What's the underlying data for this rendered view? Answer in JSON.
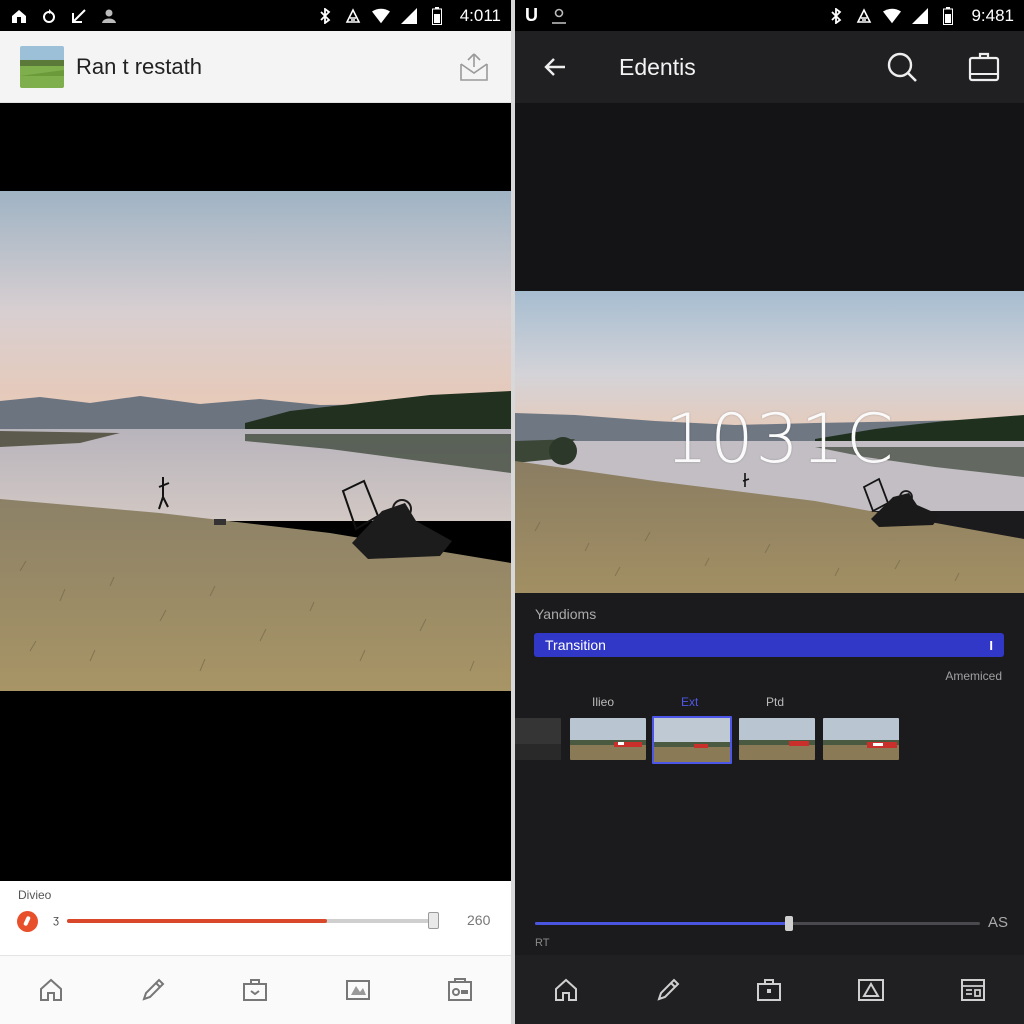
{
  "left": {
    "status": {
      "time": "4:011",
      "left_icons": [
        "home-status-icon",
        "sync-icon",
        "signal-arrow-icon",
        "person-icon"
      ],
      "right_icons": [
        "bluetooth-icon",
        "vibrate-icon",
        "wifi-icon",
        "battery-icon"
      ]
    },
    "appbar": {
      "title": "Ran t restath",
      "thumbnail": "landscape-thumbnail",
      "action_icon": "share-envelope-icon"
    },
    "controls": {
      "label": "Diviео",
      "start_mark": "ʒ",
      "end_value": "260",
      "progress_percent": 70,
      "handle_percent": 100,
      "accent": "#d9482a"
    },
    "nav": [
      "home-icon",
      "pencil-icon",
      "briefcase-icon",
      "effects-icon",
      "radio-icon"
    ]
  },
  "right": {
    "status": {
      "time": "9:481",
      "left_text": "U",
      "left_icons": [
        "person-icon"
      ],
      "right_icons": [
        "bluetooth-icon",
        "vibrate-icon",
        "wifi-icon",
        "battery-icon"
      ]
    },
    "appbar": {
      "title": "Edentis",
      "back_icon": "back-arrow-icon",
      "actions": [
        "search-icon",
        "clipboard-icon"
      ]
    },
    "overlay_text": "1031C",
    "section_label": "Yandioms",
    "transition": {
      "label": "Transition",
      "end_label": "I",
      "color": "#3138c7"
    },
    "amended_label": "Amemiced",
    "tabs": [
      {
        "label": "Ilieo",
        "active": false
      },
      {
        "label": "Ext",
        "active": true
      },
      {
        "label": "Ptd",
        "active": false
      }
    ],
    "clips": [
      {
        "selected": false,
        "faded": true
      },
      {
        "selected": false,
        "faded": false
      },
      {
        "selected": true,
        "faded": false
      },
      {
        "selected": false,
        "faded": false
      },
      {
        "selected": false,
        "faded": false
      }
    ],
    "scrubber": {
      "progress_percent": 57,
      "end_label": "AS",
      "start_label": "RT"
    },
    "nav": [
      "home-icon",
      "pencil-icon",
      "briefcase-icon",
      "warning-icon",
      "document-icon"
    ],
    "accent": "#4c56e8"
  }
}
